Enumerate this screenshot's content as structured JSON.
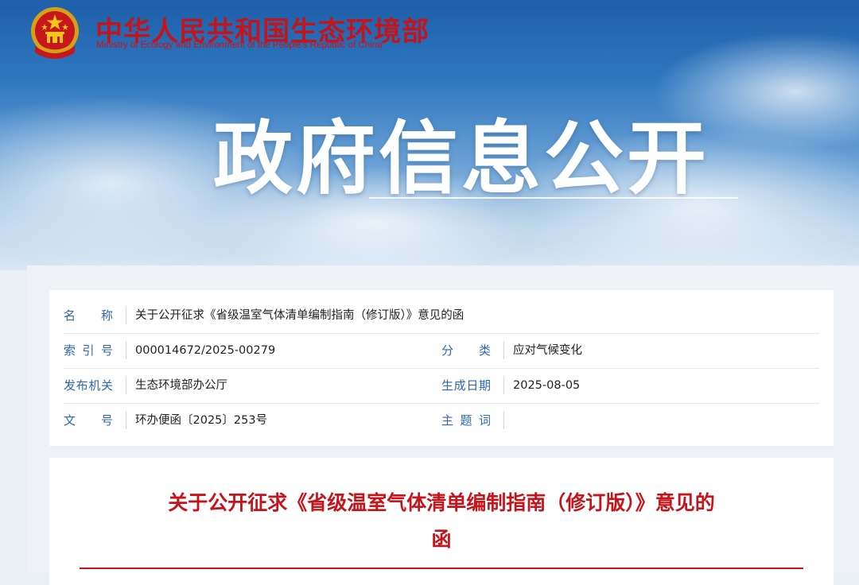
{
  "header": {
    "org_name_cn": "中华人民共和国生态环境部",
    "org_name_en": "Ministry of Ecology and Environment of the People's Republic of China",
    "banner_title": "政府信息公开"
  },
  "meta": {
    "name_label": "名　称",
    "name_value": "关于公开征求《省级温室气体清单编制指南（修订版）》意见的函",
    "index_label": "索引号",
    "index_value": "000014672/2025-00279",
    "category_label": "分　类",
    "category_value": "应对气候变化",
    "issuer_label": "发布机关",
    "issuer_value": "生态环境部办公厅",
    "date_label": "生成日期",
    "date_value": "2025-08-05",
    "docno_label": "文　号",
    "docno_value": "环办便函〔2025〕253号",
    "keywords_label": "主题词",
    "keywords_value": ""
  },
  "document": {
    "title_line1": "关于公开征求《省级温室气体清单编制指南（修订版）》意见的",
    "title_line2": "函"
  },
  "colors": {
    "brand_red": "#c4151c",
    "label_blue": "#2f65b3"
  },
  "icons": {
    "emblem": "national-emblem-icon"
  }
}
